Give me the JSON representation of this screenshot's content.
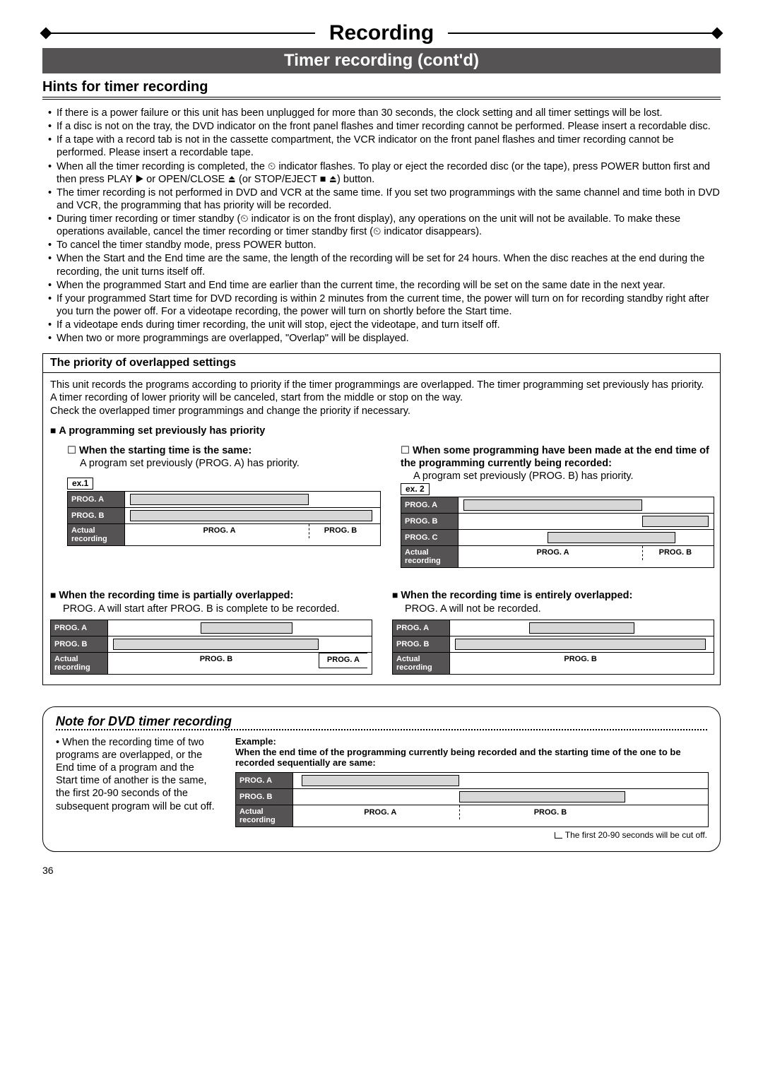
{
  "page_title": "Recording",
  "subheader": "Timer recording (cont'd)",
  "section_heading": "Hints for timer recording",
  "hints": [
    "If there is a power failure or this unit has been unplugged for more than 30 seconds, the clock setting and all timer settings will be lost.",
    "If a disc is not on the tray, the DVD indicator on the front panel flashes and timer recording cannot be performed. Please insert a recordable disc.",
    "If a tape with a record tab is not in the cassette compartment, the VCR indicator on the front panel flashes and timer recording cannot be performed. Please insert a recordable tape.",
    "When all the timer recording is completed, the ⏲ indicator flashes. To play or eject the recorded disc (or the tape), press POWER button first and then press PLAY ▶ or OPEN/CLOSE ⏏ (or STOP/EJECT ■ ⏏) button.",
    "The timer recording is not performed in DVD and VCR at the same time. If you set two programmings with the same channel and time both in DVD and VCR, the programming that has priority will be recorded.",
    "During timer recording or timer standby (⏲ indicator is on the front display), any operations on the unit will not be available. To make these operations available, cancel the timer recording or timer standby first (⏲ indicator disappears).",
    "To cancel the timer standby mode, press POWER button.",
    "When the Start and the End time are the same, the length of the recording will be set for 24 hours. When the disc reaches at the end during the recording, the unit turns itself off.",
    "When the programmed Start and End time are earlier than the current time, the recording will be set on the same date in the next year.",
    "If your programmed Start time for DVD recording is within 2 minutes from the current time, the power will turn on for recording standby right after you turn the power off. For a videotape recording, the power will turn on shortly before the Start time.",
    "If a videotape ends during timer recording, the unit will stop, eject the videotape, and turn itself off.",
    "When two or more programmings are overlapped, \"Overlap\" will be displayed."
  ],
  "box_heading": "The priority of overlapped settings",
  "box_intro": [
    "This unit records the programs according to priority if the timer programmings are overlapped. The timer programming set previously has priority.",
    "A timer recording of lower priority will be canceled, start from the middle or stop on the way.",
    "Check the overlapped timer programmings and change the priority if necessary."
  ],
  "rule_heading": "A programming set previously has priority",
  "case1": {
    "title": "When the starting time is the same:",
    "desc": "A program set previously (PROG. A) has priority.",
    "ex_label": "ex.1",
    "rows": [
      "PROG. A",
      "PROG. B",
      "Actual recording"
    ],
    "result": [
      "PROG. A",
      "PROG. B"
    ]
  },
  "case2": {
    "title": "When some programming have been made at the end time of the programming currently being recorded:",
    "desc": "A program set previously (PROG. B) has priority.",
    "ex_label": "ex. 2",
    "rows": [
      "PROG. A",
      "PROG. B",
      "PROG. C",
      "Actual recording"
    ],
    "result": [
      "PROG. A",
      "PROG. B"
    ]
  },
  "case3": {
    "title": "When the recording time is partially overlapped:",
    "desc": "PROG. A will start after PROG. B is complete to be recorded.",
    "rows": [
      "PROG. A",
      "PROG. B",
      "Actual recording"
    ],
    "result": [
      "PROG. B",
      "PROG. A"
    ]
  },
  "case4": {
    "title": "When the recording time is entirely overlapped:",
    "desc": "PROG. A will not be recorded.",
    "rows": [
      "PROG. A",
      "PROG. B",
      "Actual recording"
    ],
    "result": [
      "PROG. B"
    ]
  },
  "note": {
    "title": "Note for DVD timer recording",
    "left_text": "When the recording time of two programs are overlapped, or the End time of a program and the Start time of another is the same, the first 20-90 seconds of the subsequent program will be cut off.",
    "example_heading": "Example:",
    "example_desc": "When the end time of the programming currently being recorded and the starting time of the one to be recorded sequentially are same:",
    "rows": [
      "PROG. A",
      "PROG. B",
      "Actual recording"
    ],
    "result": [
      "PROG. A",
      "PROG. B"
    ],
    "footnote": "The first 20-90 seconds will be cut off."
  },
  "page_number": "36"
}
